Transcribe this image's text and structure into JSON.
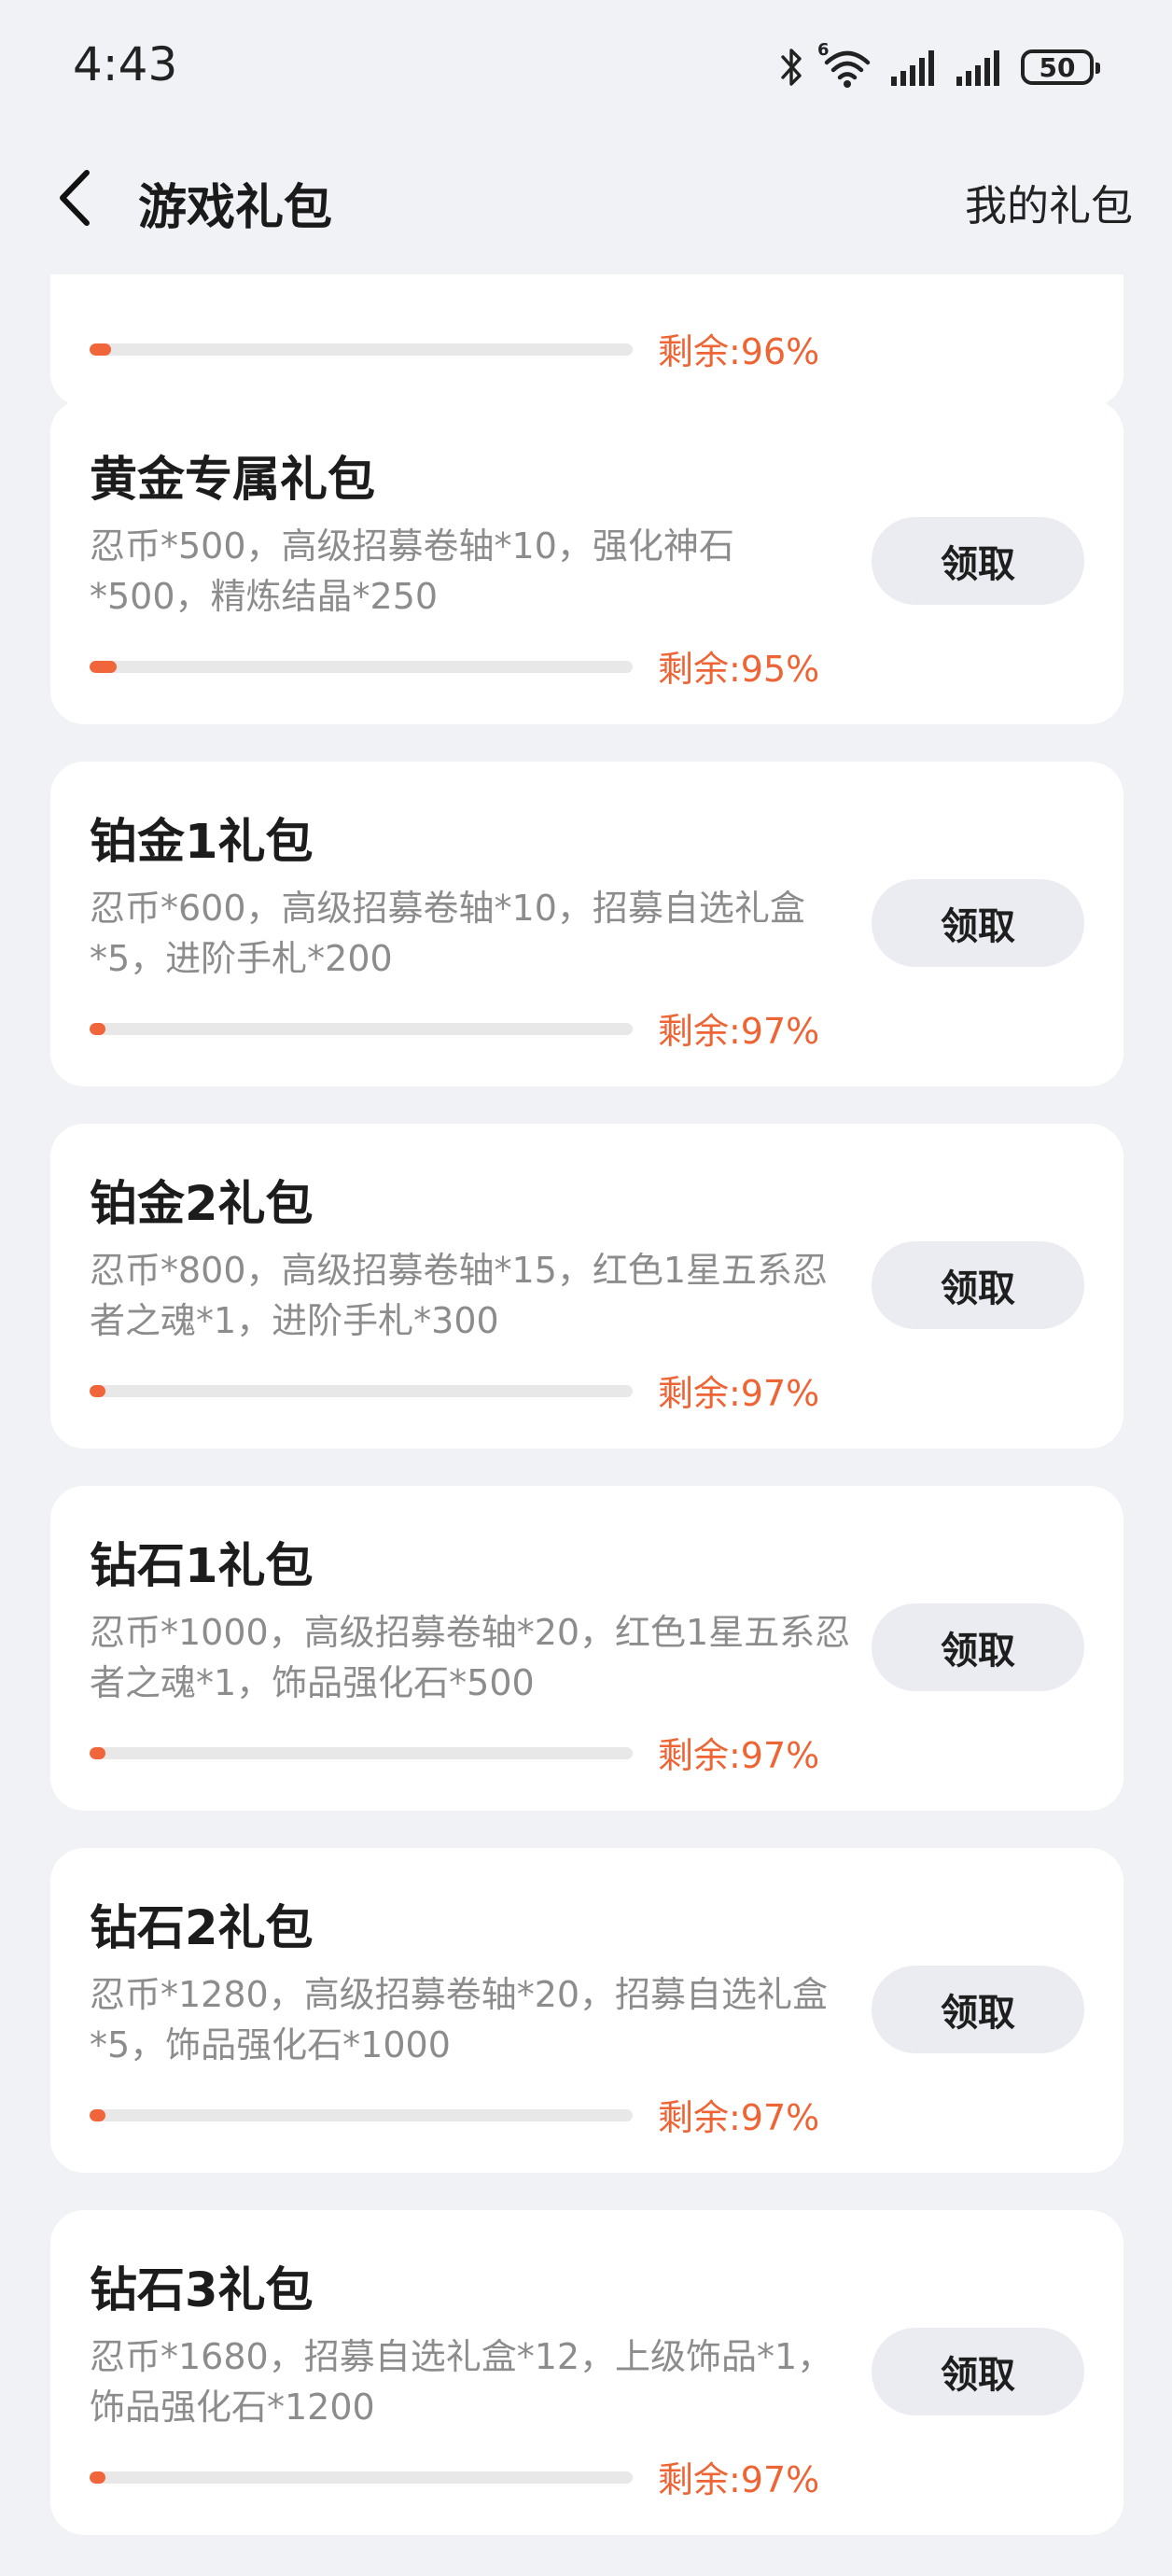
{
  "status_bar": {
    "time": "4:43",
    "network_badge": "6",
    "battery": "50",
    "icons": [
      "bluetooth-icon",
      "wifi-icon",
      "signal-icon",
      "signal-icon",
      "battery-icon"
    ]
  },
  "nav": {
    "back_icon": "chevron-left-icon",
    "title": "游戏礼包",
    "right_link": "我的礼包"
  },
  "colors": {
    "accent": "#f0653a",
    "background": "#f1f2f6",
    "card": "#ffffff",
    "button_bg": "#eaecf1",
    "description": "#8c8c8c"
  },
  "gifts": [
    {
      "title": "",
      "description": "",
      "remaining_text": "剩余:96%",
      "claimed_fraction": 0.04,
      "button_label": ""
    },
    {
      "title": "黄金专属礼包",
      "description": "忍币*500，高级招募卷轴*10，强化神石*500，精炼结晶*250",
      "remaining_text": "剩余:95%",
      "claimed_fraction": 0.05,
      "button_label": "领取"
    },
    {
      "title": "铂金1礼包",
      "description": "忍币*600，高级招募卷轴*10，招募自选礼盒*5，进阶手札*200",
      "remaining_text": "剩余:97%",
      "claimed_fraction": 0.03,
      "button_label": "领取"
    },
    {
      "title": "铂金2礼包",
      "description": "忍币*800，高级招募卷轴*15，红色1星五系忍者之魂*1，进阶手札*300",
      "remaining_text": "剩余:97%",
      "claimed_fraction": 0.03,
      "button_label": "领取"
    },
    {
      "title": "钻石1礼包",
      "description": "忍币*1000，高级招募卷轴*20，红色1星五系忍者之魂*1，饰品强化石*500",
      "remaining_text": "剩余:97%",
      "claimed_fraction": 0.03,
      "button_label": "领取"
    },
    {
      "title": "钻石2礼包",
      "description": "忍币*1280，高级招募卷轴*20，招募自选礼盒*5，饰品强化石*1000",
      "remaining_text": "剩余:97%",
      "claimed_fraction": 0.03,
      "button_label": "领取"
    },
    {
      "title": "钻石3礼包",
      "description": "忍币*1680，招募自选礼盒*12，上级饰品*1，饰品强化石*1200",
      "remaining_text": "剩余:97%",
      "claimed_fraction": 0.03,
      "button_label": "领取"
    }
  ]
}
